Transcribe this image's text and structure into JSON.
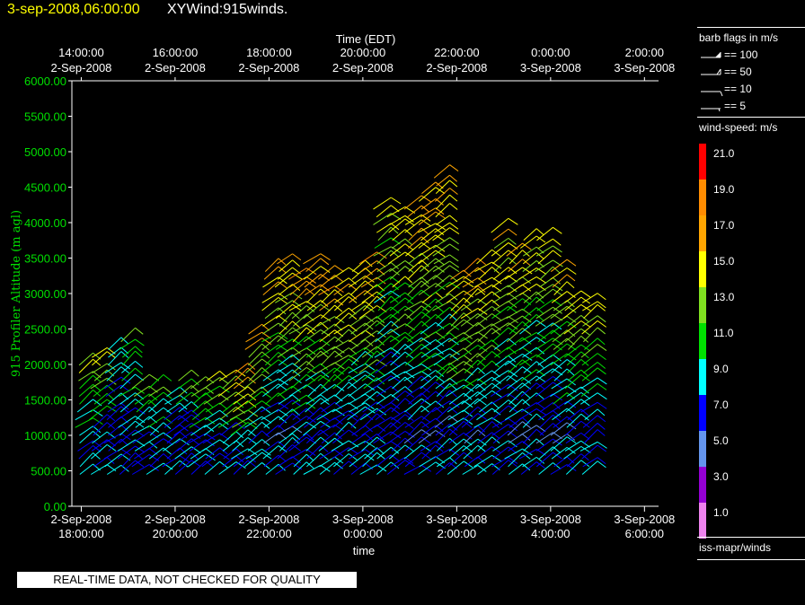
{
  "header": {
    "datetime": "3-sep-2008,06:00:00",
    "product": "XYWind:915winds."
  },
  "legend": {
    "barb_title": "barb flags in m/s",
    "barbs": [
      {
        "label": "== 100",
        "kind": "flag-100"
      },
      {
        "label": "== 50",
        "kind": "flag-50"
      },
      {
        "label": "== 10",
        "kind": "barb-10"
      },
      {
        "label": "== 5",
        "kind": "barb-5"
      }
    ],
    "speed_title": "wind-speed: m/s",
    "speed_levels": [
      {
        "value": "21.0",
        "color": "#ff0000"
      },
      {
        "value": "19.0",
        "color": "#ff8c00"
      },
      {
        "value": "17.0",
        "color": "#ffa500"
      },
      {
        "value": "15.0",
        "color": "#ffff00"
      },
      {
        "value": "13.0",
        "color": "#80e020"
      },
      {
        "value": "11.0",
        "color": "#00e000"
      },
      {
        "value": "9.0",
        "color": "#00ffff"
      },
      {
        "value": "7.0",
        "color": "#0000ff"
      },
      {
        "value": "5.0",
        "color": "#6495ed"
      },
      {
        "value": "3.0",
        "color": "#9400d3"
      },
      {
        "value": "1.0",
        "color": "#ee82ee"
      }
    ],
    "source": "iss-mapr/winds"
  },
  "quality_note": "REAL-TIME DATA, NOT CHECKED FOR QUALITY",
  "chart_data": {
    "type": "wind-barb time-height",
    "top_axis_title": "Time (EDT)",
    "top_ticks": [
      {
        "time": "14:00:00",
        "date": "2-Sep-2008"
      },
      {
        "time": "16:00:00",
        "date": "2-Sep-2008"
      },
      {
        "time": "18:00:00",
        "date": "2-Sep-2008"
      },
      {
        "time": "20:00:00",
        "date": "2-Sep-2008"
      },
      {
        "time": "22:00:00",
        "date": "2-Sep-2008"
      },
      {
        "time": "0:00:00",
        "date": "3-Sep-2008"
      },
      {
        "time": "2:00:00",
        "date": "3-Sep-2008"
      }
    ],
    "bottom_axis_title": "time",
    "bottom_ticks": [
      {
        "date": "2-Sep-2008",
        "time": "18:00:00"
      },
      {
        "date": "2-Sep-2008",
        "time": "20:00:00"
      },
      {
        "date": "2-Sep-2008",
        "time": "22:00:00"
      },
      {
        "date": "3-Sep-2008",
        "time": "0:00:00"
      },
      {
        "date": "3-Sep-2008",
        "time": "2:00:00"
      },
      {
        "date": "3-Sep-2008",
        "time": "4:00:00"
      },
      {
        "date": "3-Sep-2008",
        "time": "6:00:00"
      }
    ],
    "ylabel": "915 Profiler Altitude (m agl)",
    "yticks": [
      "0.00",
      "500.00",
      "1000.00",
      "1500.00",
      "2000.00",
      "2500.00",
      "3000.00",
      "3500.00",
      "4000.00",
      "4500.00",
      "5000.00",
      "5500.00",
      "6000.00"
    ],
    "ylim": [
      0,
      6000
    ],
    "xlim_hours": [
      18.0,
      30.3
    ],
    "profiles": [
      {
        "t": 18.25,
        "top": 2050,
        "v": 12
      },
      {
        "t": 18.55,
        "top": 2150,
        "v": 12
      },
      {
        "t": 18.85,
        "top": 2350,
        "v": 8
      },
      {
        "t": 19.15,
        "top": 2450,
        "v": 11
      },
      {
        "t": 19.45,
        "top": 1750,
        "v": 11
      },
      {
        "t": 19.75,
        "top": 1800,
        "v": 11
      },
      {
        "t": 20.1,
        "top": 1700,
        "v": 8
      },
      {
        "t": 20.35,
        "top": 1900,
        "v": 11
      },
      {
        "t": 20.65,
        "top": 1750,
        "v": 11
      },
      {
        "t": 20.95,
        "top": 1850,
        "v": 12
      },
      {
        "t": 21.3,
        "top": 1900,
        "v": 14
      },
      {
        "t": 21.55,
        "top": 1950,
        "v": 18
      },
      {
        "t": 21.85,
        "top": 2550,
        "v": 15
      },
      {
        "t": 22.2,
        "top": 3400,
        "v": 15
      },
      {
        "t": 22.5,
        "top": 3500,
        "v": 15
      },
      {
        "t": 22.8,
        "top": 3300,
        "v": 16
      },
      {
        "t": 23.1,
        "top": 3550,
        "v": 16
      },
      {
        "t": 23.4,
        "top": 3250,
        "v": 16
      },
      {
        "t": 23.7,
        "top": 3300,
        "v": 15
      },
      {
        "t": 24.05,
        "top": 3400,
        "v": 15
      },
      {
        "t": 24.3,
        "top": 3500,
        "v": 16
      },
      {
        "t": 24.6,
        "top": 4300,
        "v": 13
      },
      {
        "t": 24.9,
        "top": 4200,
        "v": 14
      },
      {
        "t": 25.25,
        "top": 4300,
        "v": 15
      },
      {
        "t": 25.55,
        "top": 4550,
        "v": 16
      },
      {
        "t": 25.85,
        "top": 4700,
        "v": 15
      },
      {
        "t": 26.15,
        "top": 3300,
        "v": 15
      },
      {
        "t": 26.45,
        "top": 3400,
        "v": 15
      },
      {
        "t": 26.75,
        "top": 3500,
        "v": 15
      },
      {
        "t": 27.1,
        "top": 4000,
        "v": 14
      },
      {
        "t": 27.4,
        "top": 3650,
        "v": 14
      },
      {
        "t": 27.7,
        "top": 3800,
        "v": 13
      },
      {
        "t": 28.05,
        "top": 3800,
        "v": 13
      },
      {
        "t": 28.35,
        "top": 3400,
        "v": 14
      },
      {
        "t": 28.65,
        "top": 3000,
        "v": 13
      },
      {
        "t": 29.0,
        "top": 3000,
        "v": 13
      }
    ]
  }
}
